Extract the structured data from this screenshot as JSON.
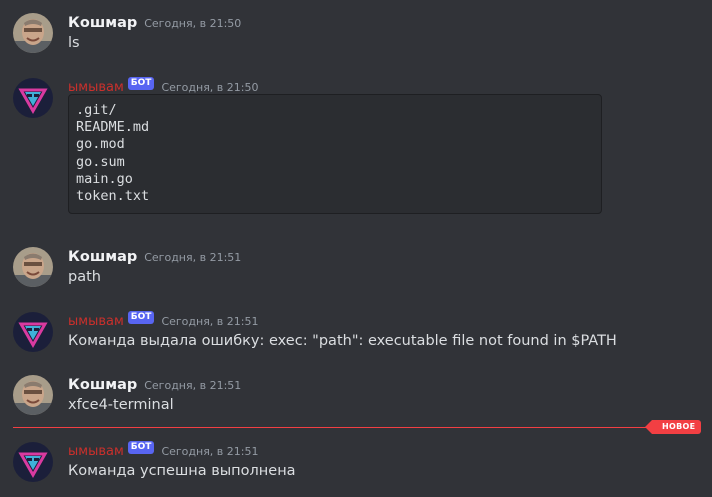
{
  "messages": [
    {
      "author": "Кошмар",
      "bot": false,
      "time": "Сегодня, в 21:50",
      "text": "ls"
    },
    {
      "author": "ымывам",
      "bot": true,
      "badge": "БОТ",
      "time": "Сегодня, в 21:50",
      "code": [
        ".git/",
        "README.md",
        "go.mod",
        "go.sum",
        "main.go",
        "token.txt"
      ]
    },
    {
      "author": "Кошмар",
      "bot": false,
      "time": "Сегодня, в 21:51",
      "text": "path"
    },
    {
      "author": "ымывам",
      "bot": true,
      "badge": "БОТ",
      "time": "Сегодня, в 21:51",
      "text": "Команда выдала ошибку: exec: \"path\": executable file not found in $PATH"
    },
    {
      "author": "Кошмар",
      "bot": false,
      "time": "Сегодня, в 21:51",
      "text": "xfce4-terminal"
    },
    {
      "author": "ымывам",
      "bot": true,
      "badge": "БОТ",
      "time": "Сегодня, в 21:51",
      "text": "Команда успешна выполнена"
    }
  ],
  "new_divider_label": "НОВОЕ",
  "colors": {
    "background": "#313338",
    "bot_name": "#c9302c",
    "badge": "#5865f2",
    "new_divider": "#f23f43"
  },
  "icons": {
    "user_avatar": "person-photo-avatar",
    "bot_avatar": "neon-v-logo-avatar"
  }
}
